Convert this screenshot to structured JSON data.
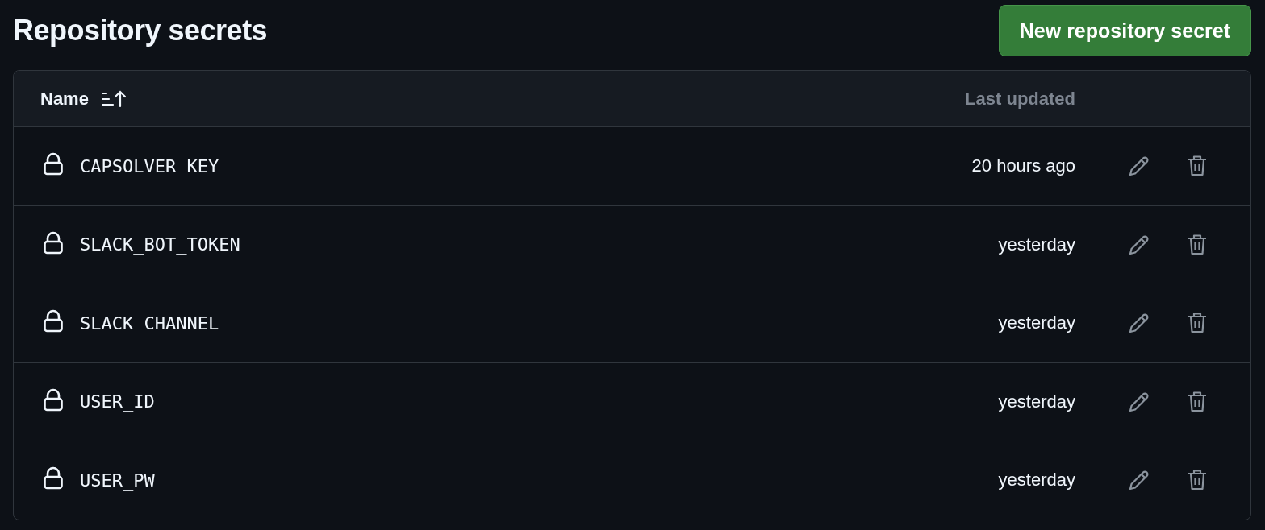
{
  "title": "Repository secrets",
  "new_button": "New repository secret",
  "table": {
    "columns": [
      "Name",
      "Last updated"
    ],
    "rows": [
      {
        "name": "CAPSOLVER_KEY",
        "updated": "20 hours ago"
      },
      {
        "name": "SLACK_BOT_TOKEN",
        "updated": "yesterday"
      },
      {
        "name": "SLACK_CHANNEL",
        "updated": "yesterday"
      },
      {
        "name": "USER_ID",
        "updated": "yesterday"
      },
      {
        "name": "USER_PW",
        "updated": "yesterday"
      }
    ]
  }
}
